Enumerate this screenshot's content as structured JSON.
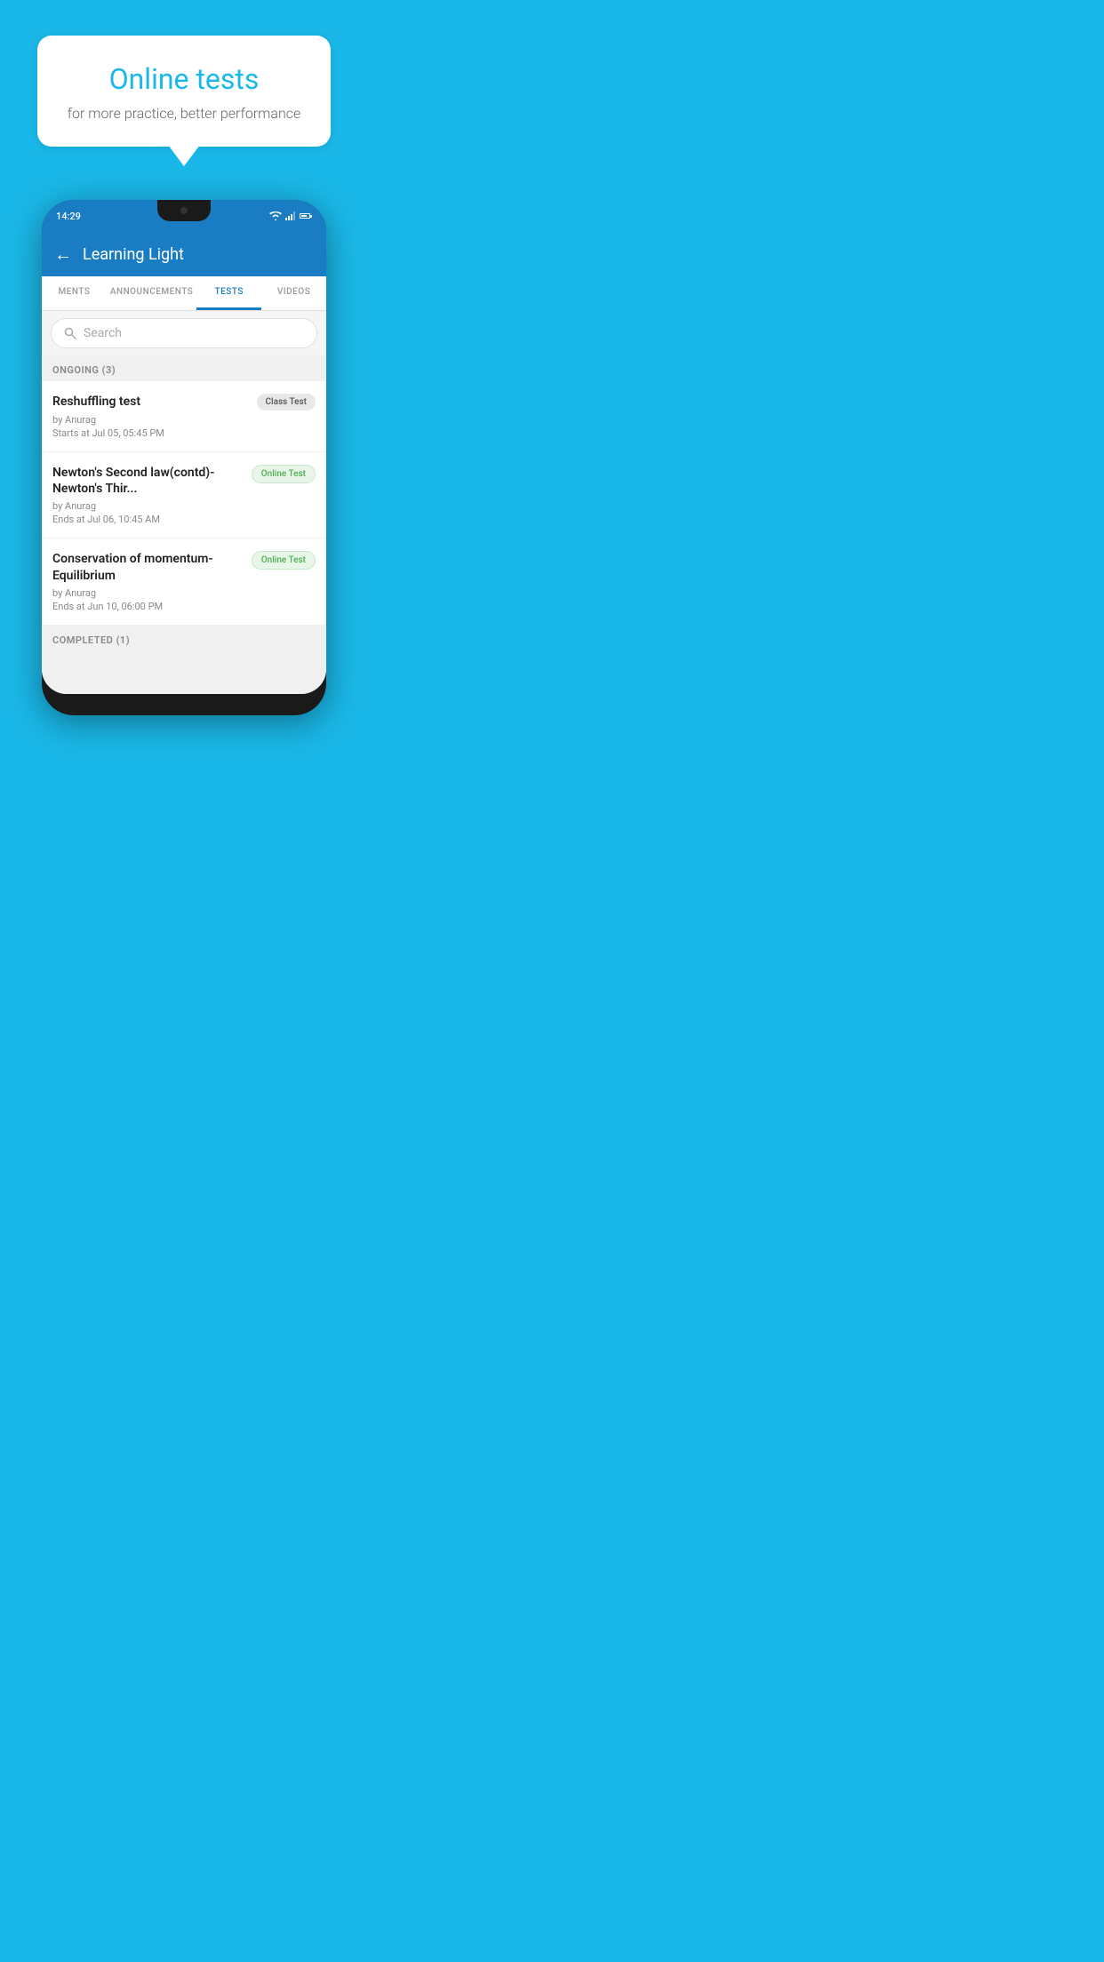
{
  "background_color": "#1ab8e8",
  "hero": {
    "bubble_title": "Online tests",
    "bubble_subtitle": "for more practice, better performance"
  },
  "phone": {
    "status_time": "14:29",
    "app_title": "Learning Light",
    "tabs": [
      {
        "id": "ments",
        "label": "MENTS",
        "active": false
      },
      {
        "id": "announcements",
        "label": "ANNOUNCEMENTS",
        "active": false
      },
      {
        "id": "tests",
        "label": "TESTS",
        "active": true
      },
      {
        "id": "videos",
        "label": "VIDEOS",
        "active": false
      }
    ],
    "search_placeholder": "Search",
    "sections": [
      {
        "header": "ONGOING (3)",
        "tests": [
          {
            "title": "Reshuffling test",
            "badge": "Class Test",
            "badge_type": "class",
            "by": "by Anurag",
            "time_label": "Starts at",
            "time": "Jul 05, 05:45 PM"
          },
          {
            "title": "Newton's Second law(contd)-Newton's Thir...",
            "badge": "Online Test",
            "badge_type": "online",
            "by": "by Anurag",
            "time_label": "Ends at",
            "time": "Jul 06, 10:45 AM"
          },
          {
            "title": "Conservation of momentum-Equilibrium",
            "badge": "Online Test",
            "badge_type": "online",
            "by": "by Anurag",
            "time_label": "Ends at",
            "time": "Jun 10, 06:00 PM"
          }
        ]
      },
      {
        "header": "COMPLETED (1)",
        "tests": []
      }
    ]
  }
}
